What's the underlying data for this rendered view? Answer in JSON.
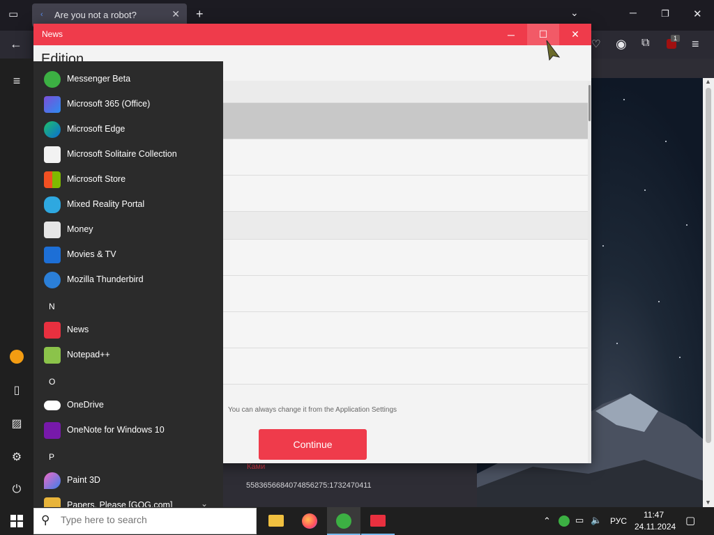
{
  "browser": {
    "tab_title": "Are you not a robot?",
    "new_tab_symbol": "+",
    "extension_badge": "1"
  },
  "web_page": {
    "label_red": "Ками",
    "id_text": "558365668407485627​5:1732470411"
  },
  "news_window": {
    "title": "News",
    "edition_label": "Edition",
    "hint": "You can always change it from the Application Settings",
    "continue_label": "Continue"
  },
  "start_menu": {
    "apps": [
      {
        "label": "Messenger Beta",
        "icon": "messenger-beta-icon"
      },
      {
        "label": "Microsoft 365 (Office)",
        "icon": "office-icon"
      },
      {
        "label": "Microsoft Edge",
        "icon": "edge-icon"
      },
      {
        "label": "Microsoft Solitaire Collection",
        "icon": "solitaire-icon"
      },
      {
        "label": "Microsoft Store",
        "icon": "store-icon"
      },
      {
        "label": "Mixed Reality Portal",
        "icon": "mixed-reality-icon"
      },
      {
        "label": "Money",
        "icon": "money-icon"
      },
      {
        "label": "Movies & TV",
        "icon": "movies-tv-icon"
      },
      {
        "label": "Mozilla Thunderbird",
        "icon": "thunderbird-icon"
      }
    ],
    "letter_n": "N",
    "apps_n": [
      {
        "label": "News",
        "icon": "news-icon"
      },
      {
        "label": "Notepad++",
        "icon": "notepadpp-icon"
      }
    ],
    "letter_o": "O",
    "apps_o": [
      {
        "label": "OneDrive",
        "icon": "onedrive-icon"
      },
      {
        "label": "OneNote for Windows 10",
        "icon": "onenote-icon"
      }
    ],
    "letter_p": "P",
    "apps_p": [
      {
        "label": "Paint 3D",
        "icon": "paint3d-icon"
      },
      {
        "label": "Papers, Please [GOG.com]",
        "icon": "folder-icon"
      }
    ]
  },
  "taskbar": {
    "search_placeholder": "Type here to search",
    "language": "РУС",
    "time": "11:47",
    "date": "24.11.2024"
  },
  "colors": {
    "accent_red": "#ef3b4b",
    "start_bg": "#2b2b2b",
    "taskbar_bg": "#1f1f1f"
  }
}
